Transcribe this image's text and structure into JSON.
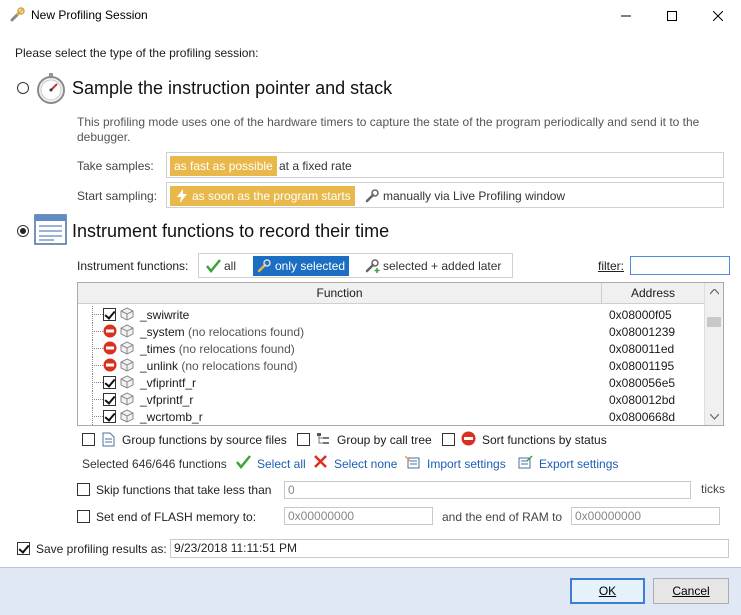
{
  "window": {
    "title": "New Profiling Session"
  },
  "prompt": "Please select the type of the profiling session:",
  "sampling": {
    "title": "Sample the instruction pointer and stack",
    "description": "This profiling mode uses one of the hardware timers to capture the state of the program periodically and send it to the debugger.",
    "take_samples_label": "Take samples:",
    "take_samples_options": [
      "as fast as possible",
      "at a fixed rate"
    ],
    "start_sampling_label": "Start sampling:",
    "start_sampling_options": [
      "as soon as the program starts",
      "manually via Live Profiling window"
    ]
  },
  "instrument": {
    "title": "Instrument functions to record their time",
    "functions_label": "Instrument functions:",
    "modes": [
      "all",
      "only selected",
      "selected + added later"
    ],
    "filter_label": "filter:",
    "filter_value": "",
    "columns": [
      "Function",
      "Address"
    ],
    "rows": [
      {
        "name": "_swiwrite",
        "note": "",
        "address": "0x08000f05",
        "state": "checked"
      },
      {
        "name": "_system",
        "note": "(no relocations found)",
        "address": "0x08001239",
        "state": "blocked"
      },
      {
        "name": "_times",
        "note": "(no relocations found)",
        "address": "0x080011ed",
        "state": "blocked"
      },
      {
        "name": "_unlink",
        "note": "(no relocations found)",
        "address": "0x08001195",
        "state": "blocked"
      },
      {
        "name": "_vfiprintf_r",
        "note": "",
        "address": "0x080056e5",
        "state": "checked"
      },
      {
        "name": "_vfprintf_r",
        "note": "",
        "address": "0x080012bd",
        "state": "checked"
      },
      {
        "name": "_wcrtomb_r",
        "note": "",
        "address": "0x0800668d",
        "state": "checked"
      }
    ],
    "options": [
      "Group functions by source files",
      "Group by call tree",
      "Sort functions by status"
    ],
    "selected_count": "Selected 646/646 functions",
    "actions": [
      "Select all",
      "Select none",
      "Import settings",
      "Export settings"
    ],
    "skip_label": "Skip functions that take less than",
    "skip_value": "0",
    "skip_unit": "ticks",
    "flash_label": "Set end of FLASH memory to:",
    "flash_value": "0x00000000",
    "ram_label": "and the end of RAM to",
    "ram_value": "0x00000000"
  },
  "save": {
    "label": "Save profiling results as:",
    "value": "9/23/2018 11:11:51 PM"
  },
  "buttons": {
    "ok": "OK",
    "cancel": "Cancel"
  },
  "colors": {
    "selected_yellow": "#e8b84a",
    "selected_blue": "#1b6ec2",
    "footer": "#dfe8f4"
  }
}
